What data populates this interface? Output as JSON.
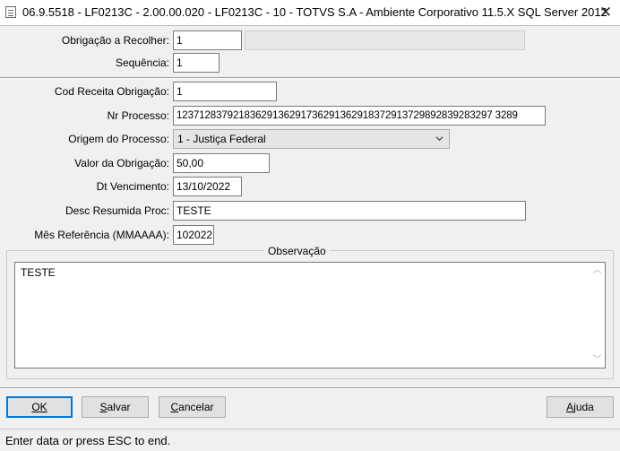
{
  "window": {
    "title": "06.9.5518 - LF0213C - 2.00.00.020 - LF0213C - 10 - TOTVS S.A - Ambiente Corporativo 11.5.X SQL Server 2012",
    "close_glyph": "✕"
  },
  "header": {
    "obrigacao_label": "Obrigação a Recolher:",
    "obrigacao_value": "1",
    "obrigacao_desc": "",
    "sequencia_label": "Sequência:",
    "sequencia_value": "1"
  },
  "form": {
    "cod_receita_label": "Cod Receita Obrigação:",
    "cod_receita_value": "1",
    "nr_processo_label": "Nr Processo:",
    "nr_processo_value": "12371283792183629136291736291362918372913729892839283297 3289",
    "origem_label": "Origem do Processo:",
    "origem_value": "1 - Justiça Federal",
    "valor_label": "Valor da Obrigação:",
    "valor_value": "50,00",
    "dt_venc_label": "Dt Vencimento:",
    "dt_venc_value": "13/10/2022",
    "desc_label": "Desc Resumida Proc:",
    "desc_value": "TESTE",
    "mes_ref_label": "Mês Referência (MMAAAA):",
    "mes_ref_value": "102022"
  },
  "observacao": {
    "title": "Observação",
    "text": "TESTE"
  },
  "buttons": {
    "ok_u": "O",
    "ok_rest": "K",
    "salvar_u": "S",
    "salvar_rest": "alvar",
    "cancelar_u": "C",
    "cancelar_rest": "ancelar",
    "ajuda_u": "A",
    "ajuda_rest": "juda"
  },
  "status": {
    "message": "Enter data or press ESC to end."
  }
}
